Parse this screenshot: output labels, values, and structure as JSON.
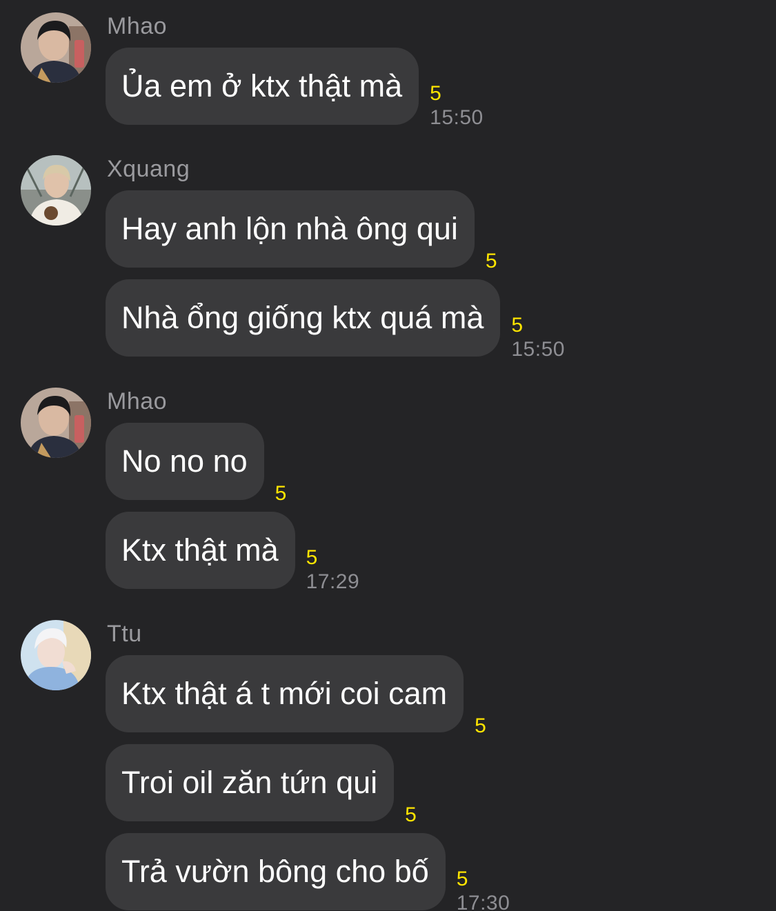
{
  "groups": [
    {
      "sender": "Mhao",
      "avatar_icon": "avatar-mhao",
      "messages": [
        {
          "text": "Ủa em ở ktx thật mà",
          "count": "5",
          "time": "15:50"
        }
      ]
    },
    {
      "sender": "Xquang",
      "avatar_icon": "avatar-xquang",
      "messages": [
        {
          "text": "Hay anh lộn nhà ông qui",
          "count": "5",
          "time": ""
        },
        {
          "text": "Nhà ổng giống ktx quá mà",
          "count": "5",
          "time": "15:50"
        }
      ]
    },
    {
      "sender": "Mhao",
      "avatar_icon": "avatar-mhao",
      "messages": [
        {
          "text": "No no no",
          "count": "5",
          "time": ""
        },
        {
          "text": "Ktx thật mà",
          "count": "5",
          "time": "17:29"
        }
      ]
    },
    {
      "sender": "Ttu",
      "avatar_icon": "avatar-ttu",
      "messages": [
        {
          "text": "Ktx thật á t mới coi cam",
          "count": "5",
          "time": ""
        },
        {
          "text": "Troi oil zăn tứn qui",
          "count": "5",
          "time": ""
        },
        {
          "text": "Trả vườn bông cho bố",
          "count": "5",
          "time": "17:30"
        }
      ]
    }
  ],
  "colors": {
    "background": "#242426",
    "bubble": "#3a3a3c",
    "text": "#ffffff",
    "sender": "#9a9a9e",
    "count": "#ffe500",
    "time": "#8e8e93"
  }
}
